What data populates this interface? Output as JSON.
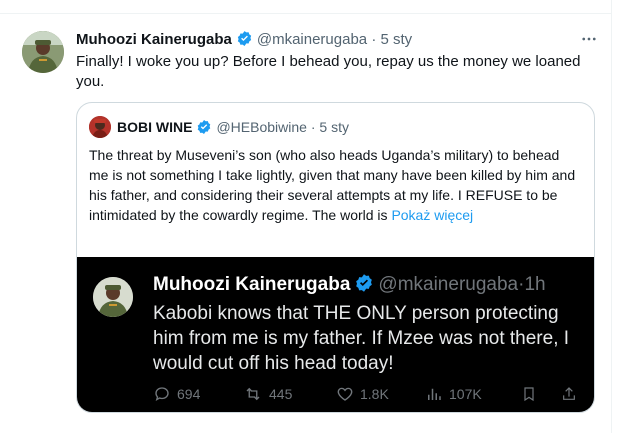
{
  "tweet": {
    "name": "Muhoozi Kainerugaba",
    "handle": "@mkainerugaba",
    "separator": "·",
    "time": "5 sty",
    "text": "Finally! I woke you up? Before I behead you, repay us the money we loaned you."
  },
  "quote": {
    "name": "BOBI WINE",
    "handle": "@HEBobiwine",
    "separator": "·",
    "time": "5 sty",
    "text": "The threat by Museveni’s son (who also heads Uganda’s military) to behead me is not something I take lightly, given that many have been killed by him and his father, and considering their several attempts at my life. I REFUSE to be intimidated by the cowardly regime. The world is",
    "more_label": "Pokaż więcej"
  },
  "embedded_tweet": {
    "name": "Muhoozi Kainerugaba",
    "handle": "@mkainerugaba",
    "separator": "·",
    "time": "1h",
    "text": "Kabobi knows that THE ONLY person protecting him from me is my father. If Mzee was not there, I would cut off his head today!",
    "replies": "694",
    "reposts": "445",
    "likes": "1.8K",
    "views": "107K"
  },
  "colors": {
    "verified": "#1d9bf0",
    "link": "#1d9bf0",
    "embed_background": "#000000"
  }
}
